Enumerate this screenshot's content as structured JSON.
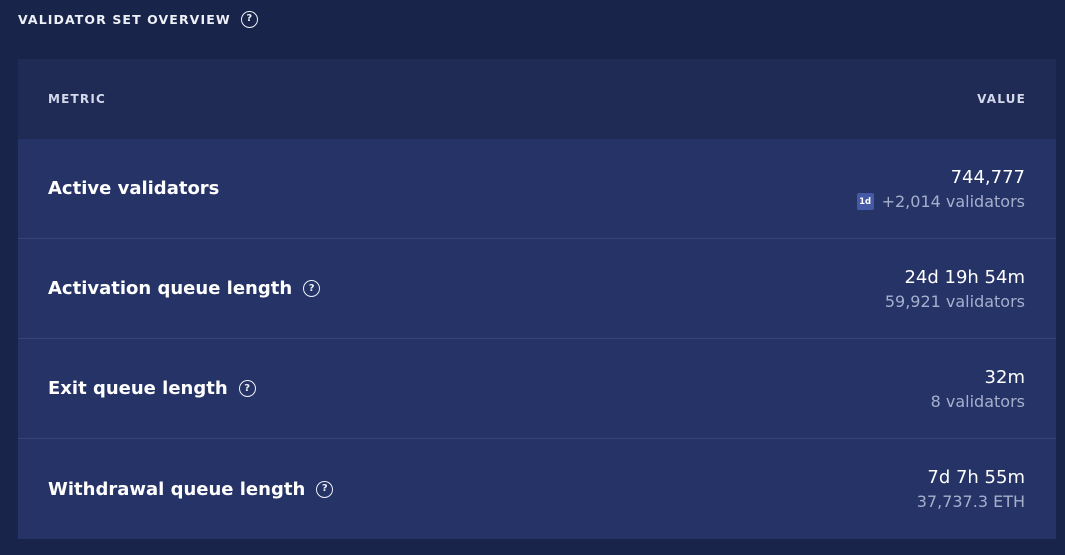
{
  "header": {
    "title": "VALIDATOR SET OVERVIEW",
    "help_icon": "question-circle-icon"
  },
  "table": {
    "columns": {
      "metric": "METRIC",
      "value": "VALUE"
    },
    "rows": [
      {
        "label": "Active validators",
        "value": "744,777",
        "badge": "1d",
        "sub": "+2,014 validators",
        "has_help": false
      },
      {
        "label": "Activation queue length",
        "value": "24d 19h 54m",
        "sub": "59,921 validators",
        "has_help": true
      },
      {
        "label": "Exit queue length",
        "value": "32m",
        "sub": "8 validators",
        "has_help": true
      },
      {
        "label": "Withdrawal queue length",
        "value": "7d 7h 55m",
        "sub": "37,737.3 ETH",
        "has_help": true
      }
    ]
  },
  "icons": {
    "help_glyph": "?"
  },
  "colors": {
    "page_background": "#18244a",
    "table_header_background": "#1f2b55",
    "row_background": "#253367",
    "row_divider": "#35437c",
    "badge_background": "#4659a5",
    "secondary_text": "#a6afcc"
  }
}
